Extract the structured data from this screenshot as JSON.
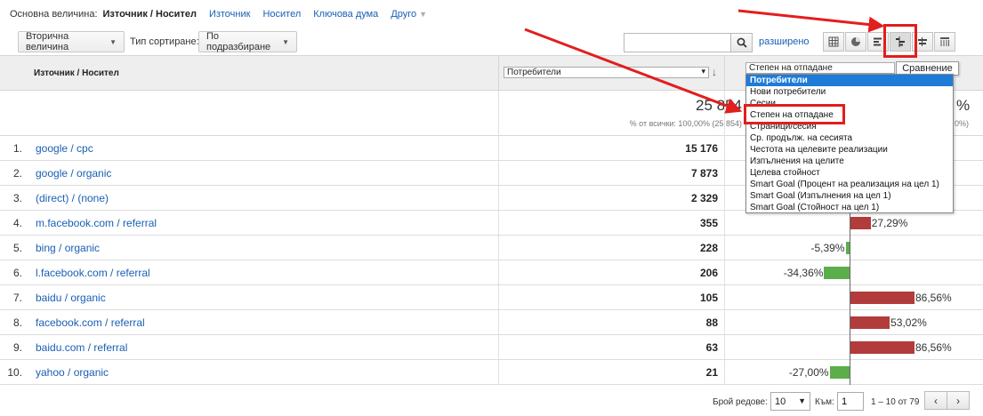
{
  "primary": {
    "label": "Основна величина:",
    "active": "Източник / Носител",
    "links": [
      "Източник",
      "Носител",
      "Ключова дума"
    ],
    "other": "Друго"
  },
  "controls": {
    "secondary_dim": "Вторична величина",
    "sort_label": "Тип сортиране:",
    "sort_value": "По подразбиране",
    "search_placeholder": "",
    "advanced": "разширено"
  },
  "view_buttons": [
    {
      "icon": "data-table-icon"
    },
    {
      "icon": "pie-chart-icon"
    },
    {
      "icon": "performance-icon"
    },
    {
      "icon": "comparison-icon"
    },
    {
      "icon": "term-cloud-icon"
    },
    {
      "icon": "pivot-icon"
    }
  ],
  "tooltip": "Сравнение",
  "header": {
    "dimension": "Източник / Носител",
    "metric": "Потребители",
    "compare": "Степен на отпадане"
  },
  "totals": {
    "value": "25 854",
    "share": "% от всички: 100,00% (25 854)",
    "right_value": "%",
    "right_share": "0%)"
  },
  "dropdown": [
    "Потребители",
    "Нови потребители",
    "Сесии",
    "Степен на отпадане",
    "Страници/сесия",
    "Ср. продълж. на сесията",
    "Честота на целевите реализации",
    "Изпълнения на целите",
    "Целева стойност",
    "Smart Goal (Процент на реализация на цел 1)",
    "Smart Goal (Изпълнения на цел 1)",
    "Smart Goal (Стойност на цел 1)"
  ],
  "rows": [
    {
      "idx": "1.",
      "dim": "google / cpc",
      "value": "15 176",
      "pct": "",
      "delta": 0
    },
    {
      "idx": "2.",
      "dim": "google / organic",
      "value": "7 873",
      "pct": "",
      "delta": 0
    },
    {
      "idx": "3.",
      "dim": "(direct) / (none)",
      "value": "2 329",
      "pct": "",
      "delta": 0
    },
    {
      "idx": "4.",
      "dim": "m.facebook.com / referral",
      "value": "355",
      "pct": "27,29%",
      "delta": 27.29
    },
    {
      "idx": "5.",
      "dim": "bing / organic",
      "value": "228",
      "pct": "-5,39%",
      "delta": -5.39
    },
    {
      "idx": "6.",
      "dim": "l.facebook.com / referral",
      "value": "206",
      "pct": "-34,36%",
      "delta": -34.36
    },
    {
      "idx": "7.",
      "dim": "baidu / organic",
      "value": "105",
      "pct": "86,56%",
      "delta": 86.56
    },
    {
      "idx": "8.",
      "dim": "facebook.com / referral",
      "value": "88",
      "pct": "53,02%",
      "delta": 53.02
    },
    {
      "idx": "9.",
      "dim": "baidu.com / referral",
      "value": "63",
      "pct": "86,56%",
      "delta": 86.56
    },
    {
      "idx": "10.",
      "dim": "yahoo / organic",
      "value": "21",
      "pct": "-27,00%",
      "delta": -27.0
    }
  ],
  "footer": {
    "rows_label": "Брой редове:",
    "rows_value": "10",
    "goto_label": "Към:",
    "goto_value": "1",
    "range": "1 – 10 от 79"
  },
  "colors": {
    "positive_bar": "#b23b3b",
    "negative_bar": "#5cae4a",
    "link": "#1a5fb4",
    "highlight": "#1e7cd8",
    "annotation": "#e21e1e"
  }
}
